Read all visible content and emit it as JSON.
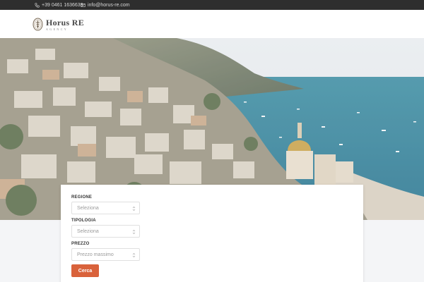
{
  "topbar": {
    "phone": "+39 0461 1636639",
    "email": "info@horus-re.com"
  },
  "brand": {
    "name": "Horus RE",
    "tagline": "AGENCY"
  },
  "hero": {
    "alt": "Positano coastline"
  },
  "search": {
    "region": {
      "label": "REGIONE",
      "value": "Seleziona"
    },
    "type": {
      "label": "TIPOLOGIA",
      "value": "Seleziona"
    },
    "price": {
      "label": "PREZZO",
      "value": "Prezzo massimo"
    },
    "submit": "Cerca"
  },
  "colors": {
    "accent": "#d9623b",
    "topbar": "#2e2e2e"
  }
}
